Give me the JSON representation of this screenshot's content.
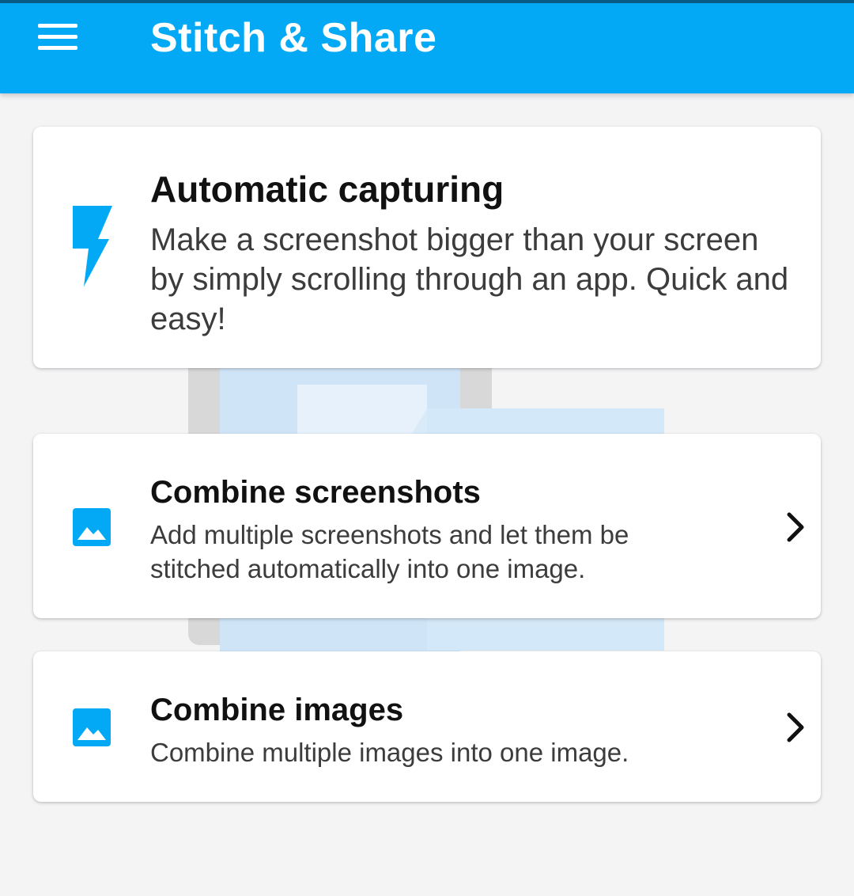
{
  "app_bar": {
    "title": "Stitch & Share",
    "background_color": "#03a9f4",
    "menu_icon": "hamburger-menu-icon"
  },
  "cards": [
    {
      "id": "automatic-capturing",
      "icon": "lightning-bolt-icon",
      "title": "Automatic capturing",
      "description": "Make a screenshot bigger than your screen by simply scrolling through an app. Quick and easy!",
      "has_chevron": false
    },
    {
      "id": "combine-screenshots",
      "icon": "image-icon",
      "title": "Combine screenshots",
      "description": "Add multiple screenshots and let them be stitched automatically into one image.",
      "has_chevron": true
    },
    {
      "id": "combine-images",
      "icon": "image-icon",
      "title": "Combine images",
      "description": "Combine multiple images into one image.",
      "has_chevron": true
    }
  ],
  "colors": {
    "accent": "#03a9f4",
    "page_background": "#f4f4f5",
    "card_background": "#ffffff"
  }
}
